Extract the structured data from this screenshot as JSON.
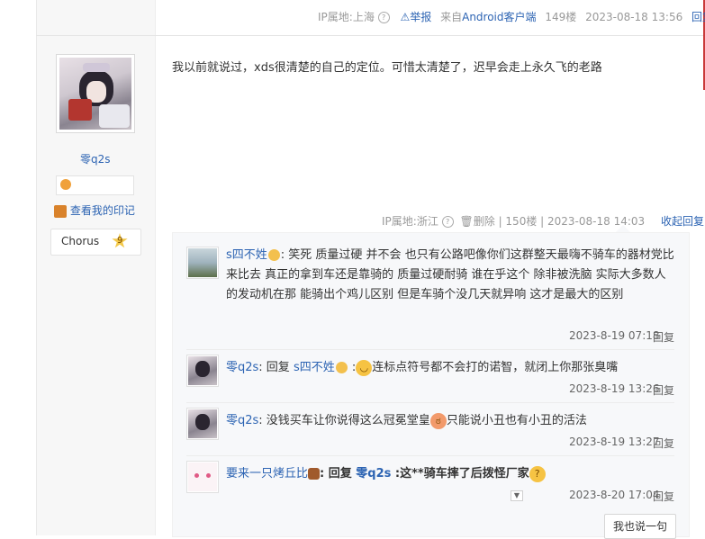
{
  "header": {
    "ip": "IP属地:上海",
    "report": "举报",
    "from_prefix": "来自",
    "from_client": "Android客户端",
    "floor": "149楼",
    "time": "2023-08-18 13:56",
    "reply": "回复"
  },
  "post": {
    "username": "零q2s",
    "content": "我以前就说过，xds很清楚的自己的定位。可惜太清楚了，迟早会走上永久飞的老路",
    "stamp_label": "查看我的印记",
    "chorus_label": "Chorus",
    "chorus_level": "9",
    "footer": {
      "ip": "IP属地:浙江",
      "delete": "删除",
      "floor": "150楼",
      "time": "2023-08-18 14:03",
      "collapse": "收起回复"
    }
  },
  "replies": [
    {
      "user": "s四不姓",
      "text": ": 笑死 质量过硬 并不会 也只有公路吧像你们这群整天最嗨不骑车的器材党比来比去 真正的拿到车还是靠骑的 质量过硬耐骑 谁在乎这个 除非被洗脑 实际大多数人的发动机在那 能骑出个鸡儿区别 但是车骑个没几天就异响 这才是最大的区别",
      "time": "2023-8-19 07:18",
      "reply": "回复"
    },
    {
      "user": "零q2s",
      "prefix": ": 回复 ",
      "target": "s四不姓",
      "text": "连标点符号都不会打的诺智，就闭上你那张臭嘴",
      "time": "2023-8-19 13:26",
      "reply": "回复"
    },
    {
      "user": "零q2s",
      "text": ": 没钱买车让你说得这么冠冕堂皇",
      "text2": "只能说小丑也有小丑的活法",
      "time": "2023-8-19 13:27",
      "reply": "回复"
    },
    {
      "user": "要来一只烤丘比",
      "prefix": ": 回复 ",
      "target": "零q2s",
      "text": " :这**骑车摔了后拨怪厂家",
      "time": "2023-8-20 17:04",
      "reply": "回复"
    }
  ],
  "say_button": "我也说一句",
  "colors": {
    "link": "#2d64b3",
    "reply_bg": "#f7f8fa"
  }
}
